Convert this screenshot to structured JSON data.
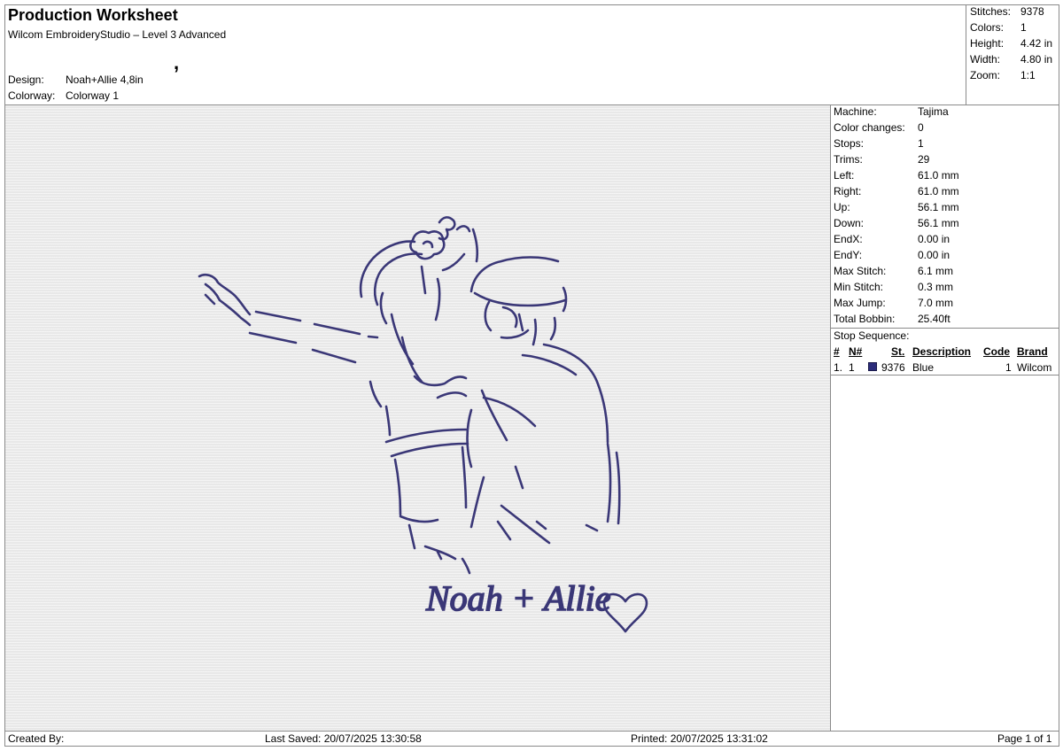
{
  "header": {
    "title": "Production Worksheet",
    "subtitle": "Wilcom EmbroideryStudio – Level 3 Advanced",
    "mark": ",",
    "design_label": "Design:",
    "design_value": "Noah+Allie 4,8in",
    "colorway_label": "Colorway:",
    "colorway_value": "Colorway 1"
  },
  "summary": [
    {
      "label": "Stitches:",
      "value": "9378"
    },
    {
      "label": "Colors:",
      "value": "1"
    },
    {
      "label": "Height:",
      "value": "4.42 in"
    },
    {
      "label": "Width:",
      "value": "4.80 in"
    },
    {
      "label": "Zoom:",
      "value": "1:1"
    }
  ],
  "details": [
    {
      "label": "Machine:",
      "value": "Tajima"
    },
    {
      "label": "Color changes:",
      "value": "0"
    },
    {
      "label": "Stops:",
      "value": "1"
    },
    {
      "label": "Trims:",
      "value": "29"
    },
    {
      "label": "Left:",
      "value": "61.0 mm"
    },
    {
      "label": "Right:",
      "value": "61.0 mm"
    },
    {
      "label": "Up:",
      "value": "56.1 mm"
    },
    {
      "label": "Down:",
      "value": "56.1 mm"
    },
    {
      "label": "EndX:",
      "value": "0.00 in"
    },
    {
      "label": "EndY:",
      "value": "0.00 in"
    },
    {
      "label": "Max Stitch:",
      "value": "6.1 mm"
    },
    {
      "label": "Min Stitch:",
      "value": "0.3 mm"
    },
    {
      "label": "Max Jump:",
      "value": "7.0 mm"
    },
    {
      "label": "Total Bobbin:",
      "value": "25.40ft"
    }
  ],
  "stop_sequence": {
    "title": "Stop Sequence:",
    "columns": [
      "#",
      "N#",
      "St.",
      "Description",
      "Code",
      "Brand"
    ],
    "rows": [
      {
        "index": "1.",
        "n": "1",
        "color": "#2b2c7a",
        "stitches": "9376",
        "description": "Blue",
        "code": "1",
        "brand": "Wilcom"
      }
    ]
  },
  "design_preview": {
    "text": "Noah + Allie",
    "thread_color": "#3a3777",
    "icon": "heart-icon"
  },
  "footer": {
    "created_by": "Created By:",
    "last_saved": "Last Saved: 20/07/2025 13:30:58",
    "printed": "Printed: 20/07/2025 13:31:02",
    "page": "Page 1 of 1"
  }
}
